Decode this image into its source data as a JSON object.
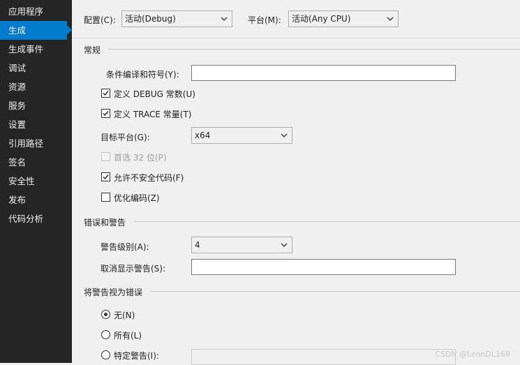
{
  "sidebar": {
    "items": [
      {
        "label": "应用程序",
        "active": false
      },
      {
        "label": "生成",
        "active": true
      },
      {
        "label": "生成事件",
        "active": false
      },
      {
        "label": "调试",
        "active": false
      },
      {
        "label": "资源",
        "active": false
      },
      {
        "label": "服务",
        "active": false
      },
      {
        "label": "设置",
        "active": false
      },
      {
        "label": "引用路径",
        "active": false
      },
      {
        "label": "签名",
        "active": false
      },
      {
        "label": "安全性",
        "active": false
      },
      {
        "label": "发布",
        "active": false
      },
      {
        "label": "代码分析",
        "active": false
      }
    ]
  },
  "header": {
    "config_label": "配置(C):",
    "config_value": "活动(Debug)",
    "platform_label": "平台(M):",
    "platform_value": "活动(Any CPU)"
  },
  "general": {
    "title": "常规",
    "symbols_label": "条件编译和符号(Y):",
    "symbols_value": "",
    "define_debug": {
      "label": "定义 DEBUG 常数(U)",
      "checked": true
    },
    "define_trace": {
      "label": "定义 TRACE 常量(T)",
      "checked": true
    },
    "target_label": "目标平台(G):",
    "target_value": "x64",
    "prefer32": {
      "label": "首选 32 位(P)",
      "checked": false,
      "enabled": false
    },
    "unsafe": {
      "label": "允许不安全代码(F)",
      "checked": true
    },
    "optimize": {
      "label": "优化编码(Z)",
      "checked": false
    }
  },
  "errors": {
    "title": "错误和警告",
    "level_label": "警告级别(A):",
    "level_value": "4",
    "suppress_label": "取消显示警告(S):",
    "suppress_value": ""
  },
  "treat": {
    "title": "将警告视为错误",
    "none": {
      "label": "无(N)",
      "selected": true
    },
    "all": {
      "label": "所有(L)",
      "selected": false
    },
    "specific": {
      "label": "特定警告(I):",
      "selected": false
    }
  },
  "watermark": "CSDN @LeonDL168"
}
